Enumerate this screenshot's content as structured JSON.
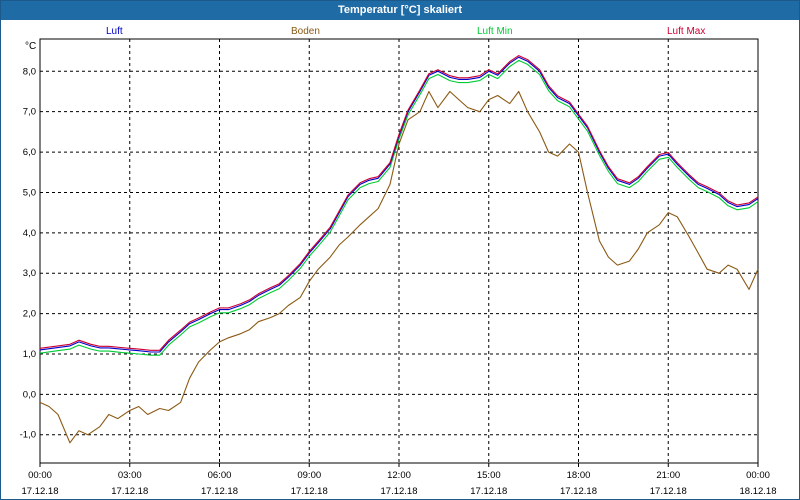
{
  "window": {
    "title": "Temperatur [°C] skaliert"
  },
  "chart_data": {
    "type": "line",
    "title": "Temperatur [°C] skaliert",
    "ylabel": "°C",
    "ylim": [
      -1.7,
      8.8
    ],
    "xlim": [
      0,
      24
    ],
    "grid": true,
    "legend_position": "top",
    "y_ticks": [
      -1.0,
      0.0,
      1.0,
      2.0,
      3.0,
      4.0,
      5.0,
      6.0,
      7.0,
      8.0
    ],
    "y_tick_labels": [
      "-1,0",
      "0,0",
      "1,0",
      "2,0",
      "3,0",
      "4,0",
      "5,0",
      "6,0",
      "7,0",
      "8,0"
    ],
    "x_ticks": [
      {
        "hour": 0,
        "time": "00:00",
        "date": "17.12.18"
      },
      {
        "hour": 3,
        "time": "03:00",
        "date": "17.12.18"
      },
      {
        "hour": 6,
        "time": "06:00",
        "date": "17.12.18"
      },
      {
        "hour": 9,
        "time": "09:00",
        "date": "17.12.18"
      },
      {
        "hour": 12,
        "time": "12:00",
        "date": "17.12.18"
      },
      {
        "hour": 15,
        "time": "15:00",
        "date": "17.12.18"
      },
      {
        "hour": 18,
        "time": "18:00",
        "date": "17.12.18"
      },
      {
        "hour": 21,
        "time": "21:00",
        "date": "17.12.18"
      },
      {
        "hour": 24,
        "time": "00:00",
        "date": "18.12.18"
      }
    ],
    "series": [
      {
        "name": "Luft",
        "color": "#0000cc",
        "x": [
          0,
          0.5,
          1,
          1.3,
          1.7,
          2,
          2.3,
          2.7,
          3,
          3.3,
          3.7,
          4,
          4.3,
          4.7,
          5,
          5.3,
          5.7,
          6,
          6.3,
          6.7,
          7,
          7.3,
          7.7,
          8,
          8.3,
          8.7,
          9,
          9.3,
          9.7,
          10,
          10.3,
          10.7,
          11,
          11.3,
          11.7,
          12,
          12.3,
          12.7,
          13,
          13.3,
          13.7,
          14,
          14.3,
          14.7,
          15,
          15.3,
          15.7,
          16,
          16.3,
          16.7,
          17,
          17.3,
          17.7,
          18,
          18.3,
          18.7,
          19,
          19.3,
          19.7,
          20,
          20.3,
          20.7,
          21,
          21.3,
          21.7,
          22,
          22.3,
          22.7,
          23,
          23.3,
          23.7,
          24
        ],
        "y": [
          1.1,
          1.15,
          1.2,
          1.3,
          1.2,
          1.15,
          1.15,
          1.12,
          1.1,
          1.08,
          1.05,
          1.05,
          1.3,
          1.55,
          1.75,
          1.85,
          2.0,
          2.1,
          2.1,
          2.2,
          2.3,
          2.45,
          2.6,
          2.7,
          2.9,
          3.2,
          3.5,
          3.75,
          4.1,
          4.5,
          4.9,
          5.2,
          5.3,
          5.35,
          5.7,
          6.4,
          7.0,
          7.5,
          7.9,
          8.0,
          7.85,
          7.8,
          7.8,
          7.85,
          8.0,
          7.9,
          8.2,
          8.35,
          8.25,
          8.0,
          7.6,
          7.35,
          7.2,
          6.9,
          6.6,
          6.0,
          5.6,
          5.3,
          5.2,
          5.35,
          5.6,
          5.9,
          5.95,
          5.7,
          5.4,
          5.2,
          5.1,
          4.95,
          4.75,
          4.65,
          4.7,
          4.85
        ]
      },
      {
        "name": "Boden",
        "color": "#8b5a14",
        "x": [
          0,
          0.3,
          0.6,
          1,
          1.3,
          1.6,
          2,
          2.3,
          2.6,
          3,
          3.3,
          3.6,
          4,
          4.3,
          4.7,
          5,
          5.3,
          5.7,
          6,
          6.3,
          6.7,
          7,
          7.3,
          7.7,
          8,
          8.3,
          8.7,
          9,
          9.3,
          9.7,
          10,
          10.3,
          10.7,
          11,
          11.3,
          11.7,
          12,
          12.3,
          12.7,
          13,
          13.3,
          13.7,
          14,
          14.3,
          14.7,
          15,
          15.3,
          15.7,
          16,
          16.3,
          16.7,
          17,
          17.3,
          17.7,
          18,
          18.3,
          18.7,
          19,
          19.3,
          19.7,
          20,
          20.3,
          20.7,
          21,
          21.3,
          21.7,
          22,
          22.3,
          22.7,
          23,
          23.3,
          23.7,
          24
        ],
        "y": [
          -0.2,
          -0.3,
          -0.5,
          -1.2,
          -0.9,
          -1.0,
          -0.8,
          -0.5,
          -0.6,
          -0.4,
          -0.3,
          -0.5,
          -0.35,
          -0.4,
          -0.2,
          0.4,
          0.8,
          1.1,
          1.3,
          1.4,
          1.5,
          1.6,
          1.8,
          1.9,
          2.0,
          2.2,
          2.4,
          2.8,
          3.1,
          3.4,
          3.7,
          3.9,
          4.2,
          4.4,
          4.6,
          5.2,
          6.2,
          6.8,
          7.0,
          7.5,
          7.1,
          7.5,
          7.3,
          7.1,
          7.0,
          7.3,
          7.4,
          7.2,
          7.5,
          7.0,
          6.5,
          6.0,
          5.9,
          6.2,
          6.0,
          5.0,
          3.8,
          3.4,
          3.2,
          3.3,
          3.6,
          4.0,
          4.2,
          4.5,
          4.4,
          3.9,
          3.5,
          3.1,
          3.0,
          3.2,
          3.1,
          2.6,
          3.1
        ]
      },
      {
        "name": "Luft Min",
        "color": "#00cc33",
        "x": [
          0,
          0.5,
          1,
          1.3,
          1.7,
          2,
          2.3,
          2.7,
          3,
          3.3,
          3.7,
          4,
          4.3,
          4.7,
          5,
          5.3,
          5.7,
          6,
          6.3,
          6.7,
          7,
          7.3,
          7.7,
          8,
          8.3,
          8.7,
          9,
          9.3,
          9.7,
          10,
          10.3,
          10.7,
          11,
          11.3,
          11.7,
          12,
          12.3,
          12.7,
          13,
          13.3,
          13.7,
          14,
          14.3,
          14.7,
          15,
          15.3,
          15.7,
          16,
          16.3,
          16.7,
          17,
          17.3,
          17.7,
          18,
          18.3,
          18.7,
          19,
          19.3,
          19.7,
          20,
          20.3,
          20.7,
          21,
          21.3,
          21.7,
          22,
          22.3,
          22.7,
          23,
          23.3,
          23.7,
          24
        ],
        "y": [
          1.02,
          1.07,
          1.12,
          1.22,
          1.12,
          1.07,
          1.07,
          1.04,
          1.02,
          1.0,
          0.97,
          0.97,
          1.22,
          1.47,
          1.67,
          1.77,
          1.92,
          2.02,
          2.02,
          2.12,
          2.22,
          2.37,
          2.52,
          2.62,
          2.82,
          3.12,
          3.42,
          3.67,
          4.02,
          4.42,
          4.82,
          5.12,
          5.22,
          5.27,
          5.62,
          6.32,
          6.92,
          7.42,
          7.82,
          7.92,
          7.77,
          7.72,
          7.72,
          7.77,
          7.92,
          7.82,
          8.12,
          8.27,
          8.17,
          7.92,
          7.52,
          7.27,
          7.12,
          6.82,
          6.52,
          5.92,
          5.52,
          5.22,
          5.12,
          5.27,
          5.52,
          5.82,
          5.87,
          5.62,
          5.32,
          5.12,
          5.02,
          4.87,
          4.67,
          4.57,
          4.62,
          4.77
        ]
      },
      {
        "name": "Luft Max",
        "color": "#cc0033",
        "x": [
          0,
          0.5,
          1,
          1.3,
          1.7,
          2,
          2.3,
          2.7,
          3,
          3.3,
          3.7,
          4,
          4.3,
          4.7,
          5,
          5.3,
          5.7,
          6,
          6.3,
          6.7,
          7,
          7.3,
          7.7,
          8,
          8.3,
          8.7,
          9,
          9.3,
          9.7,
          10,
          10.3,
          10.7,
          11,
          11.3,
          11.7,
          12,
          12.3,
          12.7,
          13,
          13.3,
          13.7,
          14,
          14.3,
          14.7,
          15,
          15.3,
          15.7,
          16,
          16.3,
          16.7,
          17,
          17.3,
          17.7,
          18,
          18.3,
          18.7,
          19,
          19.3,
          19.7,
          20,
          20.3,
          20.7,
          21,
          21.3,
          21.7,
          22,
          22.3,
          22.7,
          23,
          23.3,
          23.7,
          24
        ],
        "y": [
          1.14,
          1.19,
          1.24,
          1.34,
          1.24,
          1.19,
          1.19,
          1.16,
          1.14,
          1.12,
          1.09,
          1.09,
          1.34,
          1.59,
          1.79,
          1.89,
          2.04,
          2.14,
          2.14,
          2.24,
          2.34,
          2.49,
          2.64,
          2.74,
          2.94,
          3.24,
          3.54,
          3.79,
          4.14,
          4.54,
          4.94,
          5.24,
          5.34,
          5.39,
          5.74,
          6.44,
          7.04,
          7.54,
          7.94,
          8.04,
          7.89,
          7.84,
          7.84,
          7.89,
          8.04,
          7.94,
          8.24,
          8.39,
          8.29,
          8.04,
          7.64,
          7.39,
          7.24,
          6.94,
          6.64,
          6.04,
          5.64,
          5.34,
          5.24,
          5.39,
          5.64,
          5.94,
          5.99,
          5.74,
          5.44,
          5.24,
          5.14,
          4.99,
          4.79,
          4.69,
          4.74,
          4.89
        ]
      }
    ]
  }
}
